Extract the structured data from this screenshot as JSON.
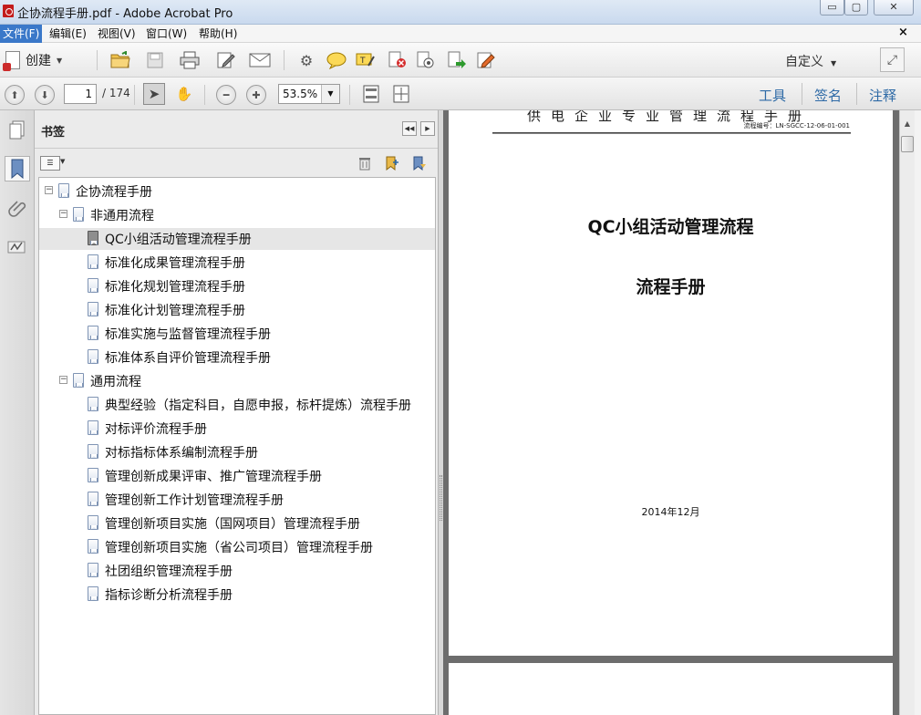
{
  "window": {
    "title": "企协流程手册.pdf - Adobe Acrobat Pro",
    "minimize": "▭",
    "maximize": "▢",
    "close": "✕"
  },
  "menu": {
    "items": [
      "文件(F)",
      "编辑(E)",
      "视图(V)",
      "窗口(W)",
      "帮助(H)"
    ],
    "close_doc": "×"
  },
  "toolbar": {
    "create_label": "创建",
    "customize_label": "自定义",
    "icons": [
      "open-icon",
      "save-icon",
      "print-icon",
      "edit-icon",
      "email-icon",
      "settings-icon",
      "comment-icon",
      "highlight-icon",
      "remove-icon",
      "convert-icon",
      "export-icon",
      "sign-icon"
    ]
  },
  "navigation": {
    "current_page": "1",
    "total_pages": "/ 174",
    "zoom": "53.5%",
    "right_tabs": [
      "工具",
      "签名",
      "注释"
    ]
  },
  "bookmarks": {
    "title": "书签",
    "tree": [
      {
        "label": "企协流程手册",
        "level": 0,
        "toggle": "−"
      },
      {
        "label": "非通用流程",
        "level": 1,
        "toggle": "−"
      },
      {
        "label": "QC小组活动管理流程手册",
        "level": 2,
        "selected": true
      },
      {
        "label": "标准化成果管理流程手册",
        "level": 2
      },
      {
        "label": "标准化规划管理流程手册",
        "level": 2
      },
      {
        "label": "标准化计划管理流程手册",
        "level": 2
      },
      {
        "label": "标准实施与监督管理流程手册",
        "level": 2
      },
      {
        "label": "标准体系自评价管理流程手册",
        "level": 2
      },
      {
        "label": "通用流程",
        "level": 1,
        "toggle": "−"
      },
      {
        "label": "典型经验（指定科目，自愿申报，标杆提炼）流程手册",
        "level": 2
      },
      {
        "label": "对标评价流程手册",
        "level": 2
      },
      {
        "label": "对标指标体系编制流程手册",
        "level": 2
      },
      {
        "label": "管理创新成果评审、推广管理流程手册",
        "level": 2
      },
      {
        "label": "管理创新工作计划管理流程手册",
        "level": 2
      },
      {
        "label": "管理创新项目实施（国网项目）管理流程手册",
        "level": 2
      },
      {
        "label": "管理创新项目实施（省公司项目）管理流程手册",
        "level": 2
      },
      {
        "label": "社团组织管理流程手册",
        "level": 2
      },
      {
        "label": "指标诊断分析流程手册",
        "level": 2
      }
    ]
  },
  "document": {
    "header_title": "供电企业专业管理流程手册",
    "header_code": "流程编号：LN-SGCC-12-06-01-001",
    "title_line1": "QC小组活动管理流程",
    "title_line2": "流程手册",
    "date": "2014年12月"
  },
  "colors": {
    "menu_active": "#3a78c9",
    "right_tab_text": "#2e6aa6",
    "doc_background": "#6d6d6d"
  }
}
